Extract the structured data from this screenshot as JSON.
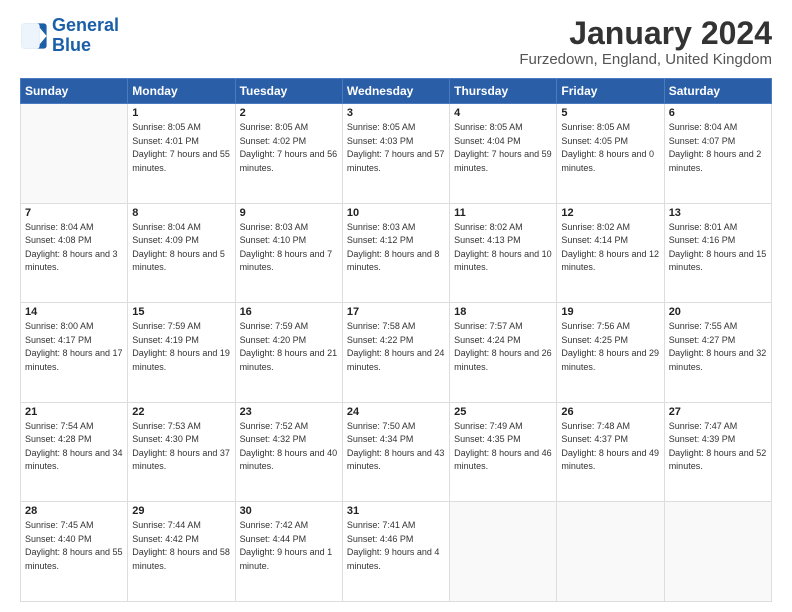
{
  "logo": {
    "line1": "General",
    "line2": "Blue"
  },
  "title": "January 2024",
  "subtitle": "Furzedown, England, United Kingdom",
  "weekdays": [
    "Sunday",
    "Monday",
    "Tuesday",
    "Wednesday",
    "Thursday",
    "Friday",
    "Saturday"
  ],
  "weeks": [
    [
      {
        "day": "",
        "sunrise": "",
        "sunset": "",
        "daylight": ""
      },
      {
        "day": "1",
        "sunrise": "Sunrise: 8:05 AM",
        "sunset": "Sunset: 4:01 PM",
        "daylight": "Daylight: 7 hours and 55 minutes."
      },
      {
        "day": "2",
        "sunrise": "Sunrise: 8:05 AM",
        "sunset": "Sunset: 4:02 PM",
        "daylight": "Daylight: 7 hours and 56 minutes."
      },
      {
        "day": "3",
        "sunrise": "Sunrise: 8:05 AM",
        "sunset": "Sunset: 4:03 PM",
        "daylight": "Daylight: 7 hours and 57 minutes."
      },
      {
        "day": "4",
        "sunrise": "Sunrise: 8:05 AM",
        "sunset": "Sunset: 4:04 PM",
        "daylight": "Daylight: 7 hours and 59 minutes."
      },
      {
        "day": "5",
        "sunrise": "Sunrise: 8:05 AM",
        "sunset": "Sunset: 4:05 PM",
        "daylight": "Daylight: 8 hours and 0 minutes."
      },
      {
        "day": "6",
        "sunrise": "Sunrise: 8:04 AM",
        "sunset": "Sunset: 4:07 PM",
        "daylight": "Daylight: 8 hours and 2 minutes."
      }
    ],
    [
      {
        "day": "7",
        "sunrise": "Sunrise: 8:04 AM",
        "sunset": "Sunset: 4:08 PM",
        "daylight": "Daylight: 8 hours and 3 minutes."
      },
      {
        "day": "8",
        "sunrise": "Sunrise: 8:04 AM",
        "sunset": "Sunset: 4:09 PM",
        "daylight": "Daylight: 8 hours and 5 minutes."
      },
      {
        "day": "9",
        "sunrise": "Sunrise: 8:03 AM",
        "sunset": "Sunset: 4:10 PM",
        "daylight": "Daylight: 8 hours and 7 minutes."
      },
      {
        "day": "10",
        "sunrise": "Sunrise: 8:03 AM",
        "sunset": "Sunset: 4:12 PM",
        "daylight": "Daylight: 8 hours and 8 minutes."
      },
      {
        "day": "11",
        "sunrise": "Sunrise: 8:02 AM",
        "sunset": "Sunset: 4:13 PM",
        "daylight": "Daylight: 8 hours and 10 minutes."
      },
      {
        "day": "12",
        "sunrise": "Sunrise: 8:02 AM",
        "sunset": "Sunset: 4:14 PM",
        "daylight": "Daylight: 8 hours and 12 minutes."
      },
      {
        "day": "13",
        "sunrise": "Sunrise: 8:01 AM",
        "sunset": "Sunset: 4:16 PM",
        "daylight": "Daylight: 8 hours and 15 minutes."
      }
    ],
    [
      {
        "day": "14",
        "sunrise": "Sunrise: 8:00 AM",
        "sunset": "Sunset: 4:17 PM",
        "daylight": "Daylight: 8 hours and 17 minutes."
      },
      {
        "day": "15",
        "sunrise": "Sunrise: 7:59 AM",
        "sunset": "Sunset: 4:19 PM",
        "daylight": "Daylight: 8 hours and 19 minutes."
      },
      {
        "day": "16",
        "sunrise": "Sunrise: 7:59 AM",
        "sunset": "Sunset: 4:20 PM",
        "daylight": "Daylight: 8 hours and 21 minutes."
      },
      {
        "day": "17",
        "sunrise": "Sunrise: 7:58 AM",
        "sunset": "Sunset: 4:22 PM",
        "daylight": "Daylight: 8 hours and 24 minutes."
      },
      {
        "day": "18",
        "sunrise": "Sunrise: 7:57 AM",
        "sunset": "Sunset: 4:24 PM",
        "daylight": "Daylight: 8 hours and 26 minutes."
      },
      {
        "day": "19",
        "sunrise": "Sunrise: 7:56 AM",
        "sunset": "Sunset: 4:25 PM",
        "daylight": "Daylight: 8 hours and 29 minutes."
      },
      {
        "day": "20",
        "sunrise": "Sunrise: 7:55 AM",
        "sunset": "Sunset: 4:27 PM",
        "daylight": "Daylight: 8 hours and 32 minutes."
      }
    ],
    [
      {
        "day": "21",
        "sunrise": "Sunrise: 7:54 AM",
        "sunset": "Sunset: 4:28 PM",
        "daylight": "Daylight: 8 hours and 34 minutes."
      },
      {
        "day": "22",
        "sunrise": "Sunrise: 7:53 AM",
        "sunset": "Sunset: 4:30 PM",
        "daylight": "Daylight: 8 hours and 37 minutes."
      },
      {
        "day": "23",
        "sunrise": "Sunrise: 7:52 AM",
        "sunset": "Sunset: 4:32 PM",
        "daylight": "Daylight: 8 hours and 40 minutes."
      },
      {
        "day": "24",
        "sunrise": "Sunrise: 7:50 AM",
        "sunset": "Sunset: 4:34 PM",
        "daylight": "Daylight: 8 hours and 43 minutes."
      },
      {
        "day": "25",
        "sunrise": "Sunrise: 7:49 AM",
        "sunset": "Sunset: 4:35 PM",
        "daylight": "Daylight: 8 hours and 46 minutes."
      },
      {
        "day": "26",
        "sunrise": "Sunrise: 7:48 AM",
        "sunset": "Sunset: 4:37 PM",
        "daylight": "Daylight: 8 hours and 49 minutes."
      },
      {
        "day": "27",
        "sunrise": "Sunrise: 7:47 AM",
        "sunset": "Sunset: 4:39 PM",
        "daylight": "Daylight: 8 hours and 52 minutes."
      }
    ],
    [
      {
        "day": "28",
        "sunrise": "Sunrise: 7:45 AM",
        "sunset": "Sunset: 4:40 PM",
        "daylight": "Daylight: 8 hours and 55 minutes."
      },
      {
        "day": "29",
        "sunrise": "Sunrise: 7:44 AM",
        "sunset": "Sunset: 4:42 PM",
        "daylight": "Daylight: 8 hours and 58 minutes."
      },
      {
        "day": "30",
        "sunrise": "Sunrise: 7:42 AM",
        "sunset": "Sunset: 4:44 PM",
        "daylight": "Daylight: 9 hours and 1 minute."
      },
      {
        "day": "31",
        "sunrise": "Sunrise: 7:41 AM",
        "sunset": "Sunset: 4:46 PM",
        "daylight": "Daylight: 9 hours and 4 minutes."
      },
      {
        "day": "",
        "sunrise": "",
        "sunset": "",
        "daylight": ""
      },
      {
        "day": "",
        "sunrise": "",
        "sunset": "",
        "daylight": ""
      },
      {
        "day": "",
        "sunrise": "",
        "sunset": "",
        "daylight": ""
      }
    ]
  ]
}
